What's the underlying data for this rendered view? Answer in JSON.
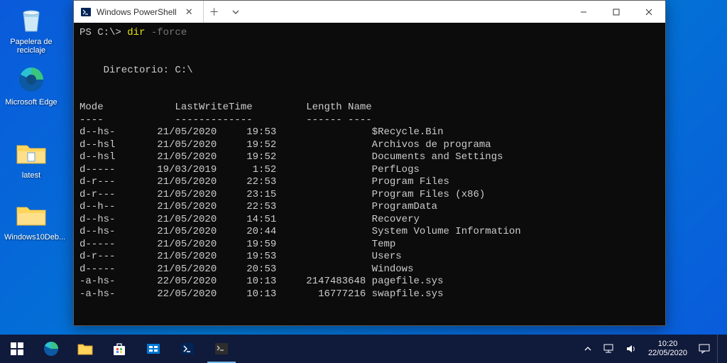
{
  "desktop": {
    "icons": [
      {
        "label": "Papelera de reciclaje"
      },
      {
        "label": "Microsoft Edge"
      },
      {
        "label": "latest"
      },
      {
        "label": "Windows10Deb..."
      }
    ]
  },
  "window": {
    "tab_title": "Windows PowerShell",
    "prompt_prefix": "PS C:\\>",
    "command_main": "dir",
    "command_arg": "-force",
    "dir_header": "Directorio: C:\\",
    "columns": {
      "mode": "Mode",
      "lastwrite": "LastWriteTime",
      "length": "Length",
      "name": "Name"
    },
    "separators": {
      "mode": "----",
      "lastwrite": "-------------",
      "length": "------",
      "name": "----"
    },
    "entries": [
      {
        "mode": "d--hs-",
        "date": "21/05/2020",
        "time": "19:53",
        "length": "",
        "name": "$Recycle.Bin"
      },
      {
        "mode": "d--hsl",
        "date": "21/05/2020",
        "time": "19:52",
        "length": "",
        "name": "Archivos de programa"
      },
      {
        "mode": "d--hsl",
        "date": "21/05/2020",
        "time": "19:52",
        "length": "",
        "name": "Documents and Settings"
      },
      {
        "mode": "d-----",
        "date": "19/03/2019",
        "time": "1:52",
        "length": "",
        "name": "PerfLogs"
      },
      {
        "mode": "d-r---",
        "date": "21/05/2020",
        "time": "22:53",
        "length": "",
        "name": "Program Files"
      },
      {
        "mode": "d-r---",
        "date": "21/05/2020",
        "time": "23:15",
        "length": "",
        "name": "Program Files (x86)"
      },
      {
        "mode": "d--h--",
        "date": "21/05/2020",
        "time": "22:53",
        "length": "",
        "name": "ProgramData"
      },
      {
        "mode": "d--hs-",
        "date": "21/05/2020",
        "time": "14:51",
        "length": "",
        "name": "Recovery"
      },
      {
        "mode": "d--hs-",
        "date": "21/05/2020",
        "time": "20:44",
        "length": "",
        "name": "System Volume Information"
      },
      {
        "mode": "d-----",
        "date": "21/05/2020",
        "time": "19:59",
        "length": "",
        "name": "Temp"
      },
      {
        "mode": "d-r---",
        "date": "21/05/2020",
        "time": "19:53",
        "length": "",
        "name": "Users"
      },
      {
        "mode": "d-----",
        "date": "21/05/2020",
        "time": "20:53",
        "length": "",
        "name": "Windows"
      },
      {
        "mode": "-a-hs-",
        "date": "22/05/2020",
        "time": "10:13",
        "length": "2147483648",
        "name": "pagefile.sys"
      },
      {
        "mode": "-a-hs-",
        "date": "22/05/2020",
        "time": "10:13",
        "length": "16777216",
        "name": "swapfile.sys"
      }
    ]
  },
  "taskbar": {
    "time": "10:20",
    "date": "22/05/2020"
  }
}
